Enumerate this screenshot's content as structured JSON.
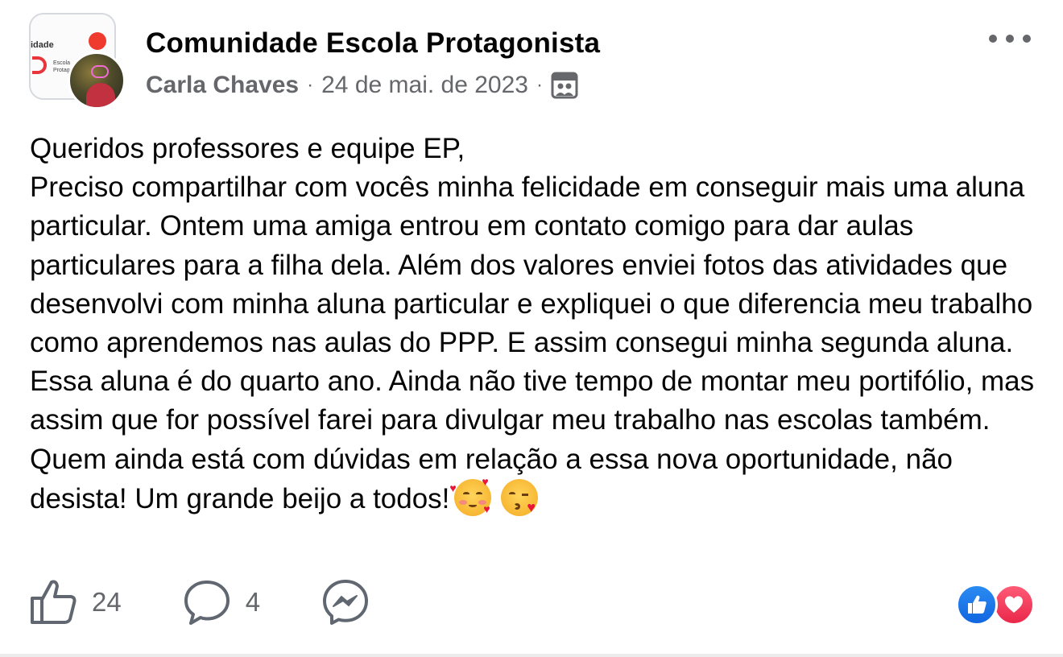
{
  "header": {
    "group_name": "Comunidade Escola Protagonista",
    "author": "Carla Chaves",
    "separator": "·",
    "date": "24 de mai. de 2023",
    "audience_icon": "group-icon",
    "group_logo_text_1": "idade",
    "group_logo_text_2": "Escola\nProtagonist"
  },
  "post": {
    "text": "Queridos professores e equipe EP,\nPreciso compartilhar com vocês minha felicidade em conseguir mais uma aluna particular. Ontem uma amiga entrou em contato comigo para dar aulas particulares para a filha dela. Além dos valores enviei fotos das atividades que desenvolvi com minha aluna particular e expliquei o que diferencia meu trabalho como aprendemos nas aulas do PPP. E assim consegui minha segunda aluna. Essa aluna é do quarto ano. Ainda não tive tempo de montar meu portifólio, mas assim que for possível farei para divulgar meu trabalho nas escolas também. Quem ainda está com dúvidas em relação a essa nova oportunidade, não desista! Um grande beijo a todos!",
    "emojis": [
      "smiling-face-with-hearts",
      "face-blowing-a-kiss"
    ]
  },
  "footer": {
    "like_count": "24",
    "comment_count": "4",
    "reactions": [
      "like",
      "love"
    ]
  },
  "colors": {
    "text": "#050505",
    "secondary_text": "#65676b",
    "like_blue": "#1877f2",
    "love_red": "#f0284a"
  }
}
